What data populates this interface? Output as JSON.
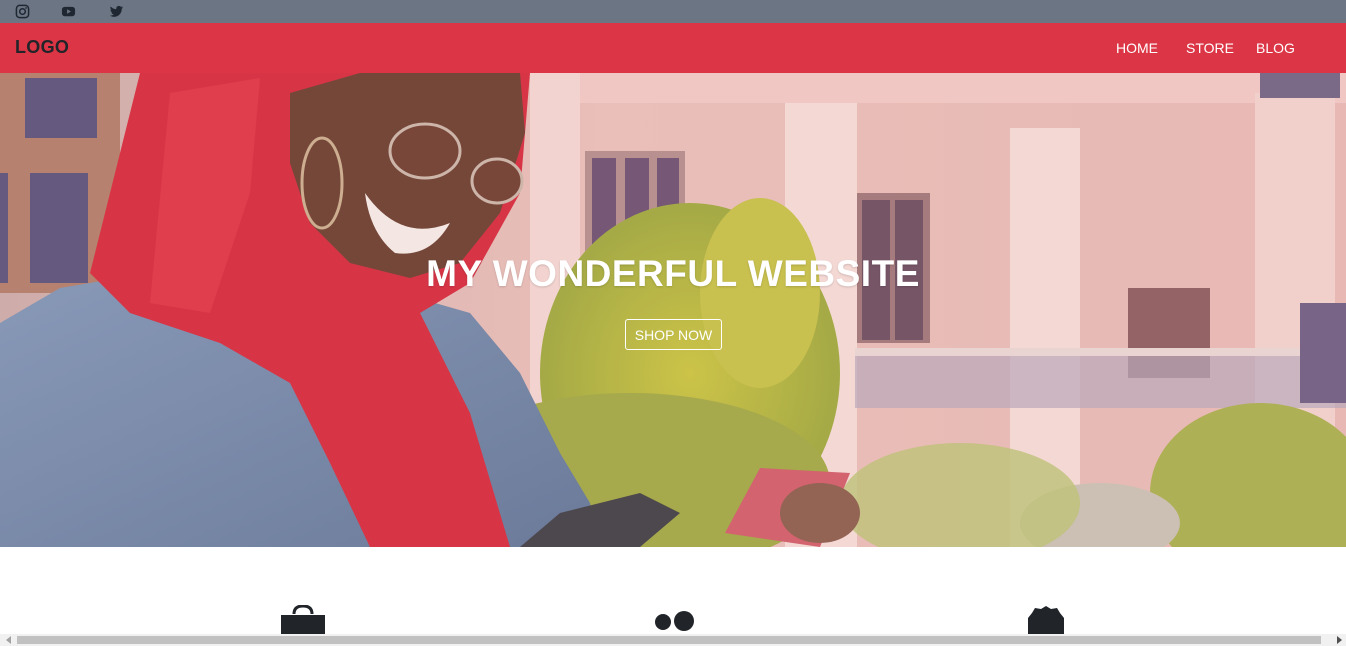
{
  "topbar": {
    "icons": [
      "instagram-icon",
      "youtube-icon",
      "twitter-icon"
    ]
  },
  "navbar": {
    "logo": "LOGO",
    "links": [
      "HOME",
      "STORE",
      "BLOG"
    ]
  },
  "hero": {
    "title": "MY WONDERFUL WEBSITE",
    "button": "SHOP NOW"
  },
  "features": {
    "icons": [
      "shopping-bag-icon",
      "dots-icon",
      "badge-icon"
    ]
  },
  "colors": {
    "topbar": "#6c7583",
    "navbar": "#dc3545",
    "logo": "#212529"
  }
}
